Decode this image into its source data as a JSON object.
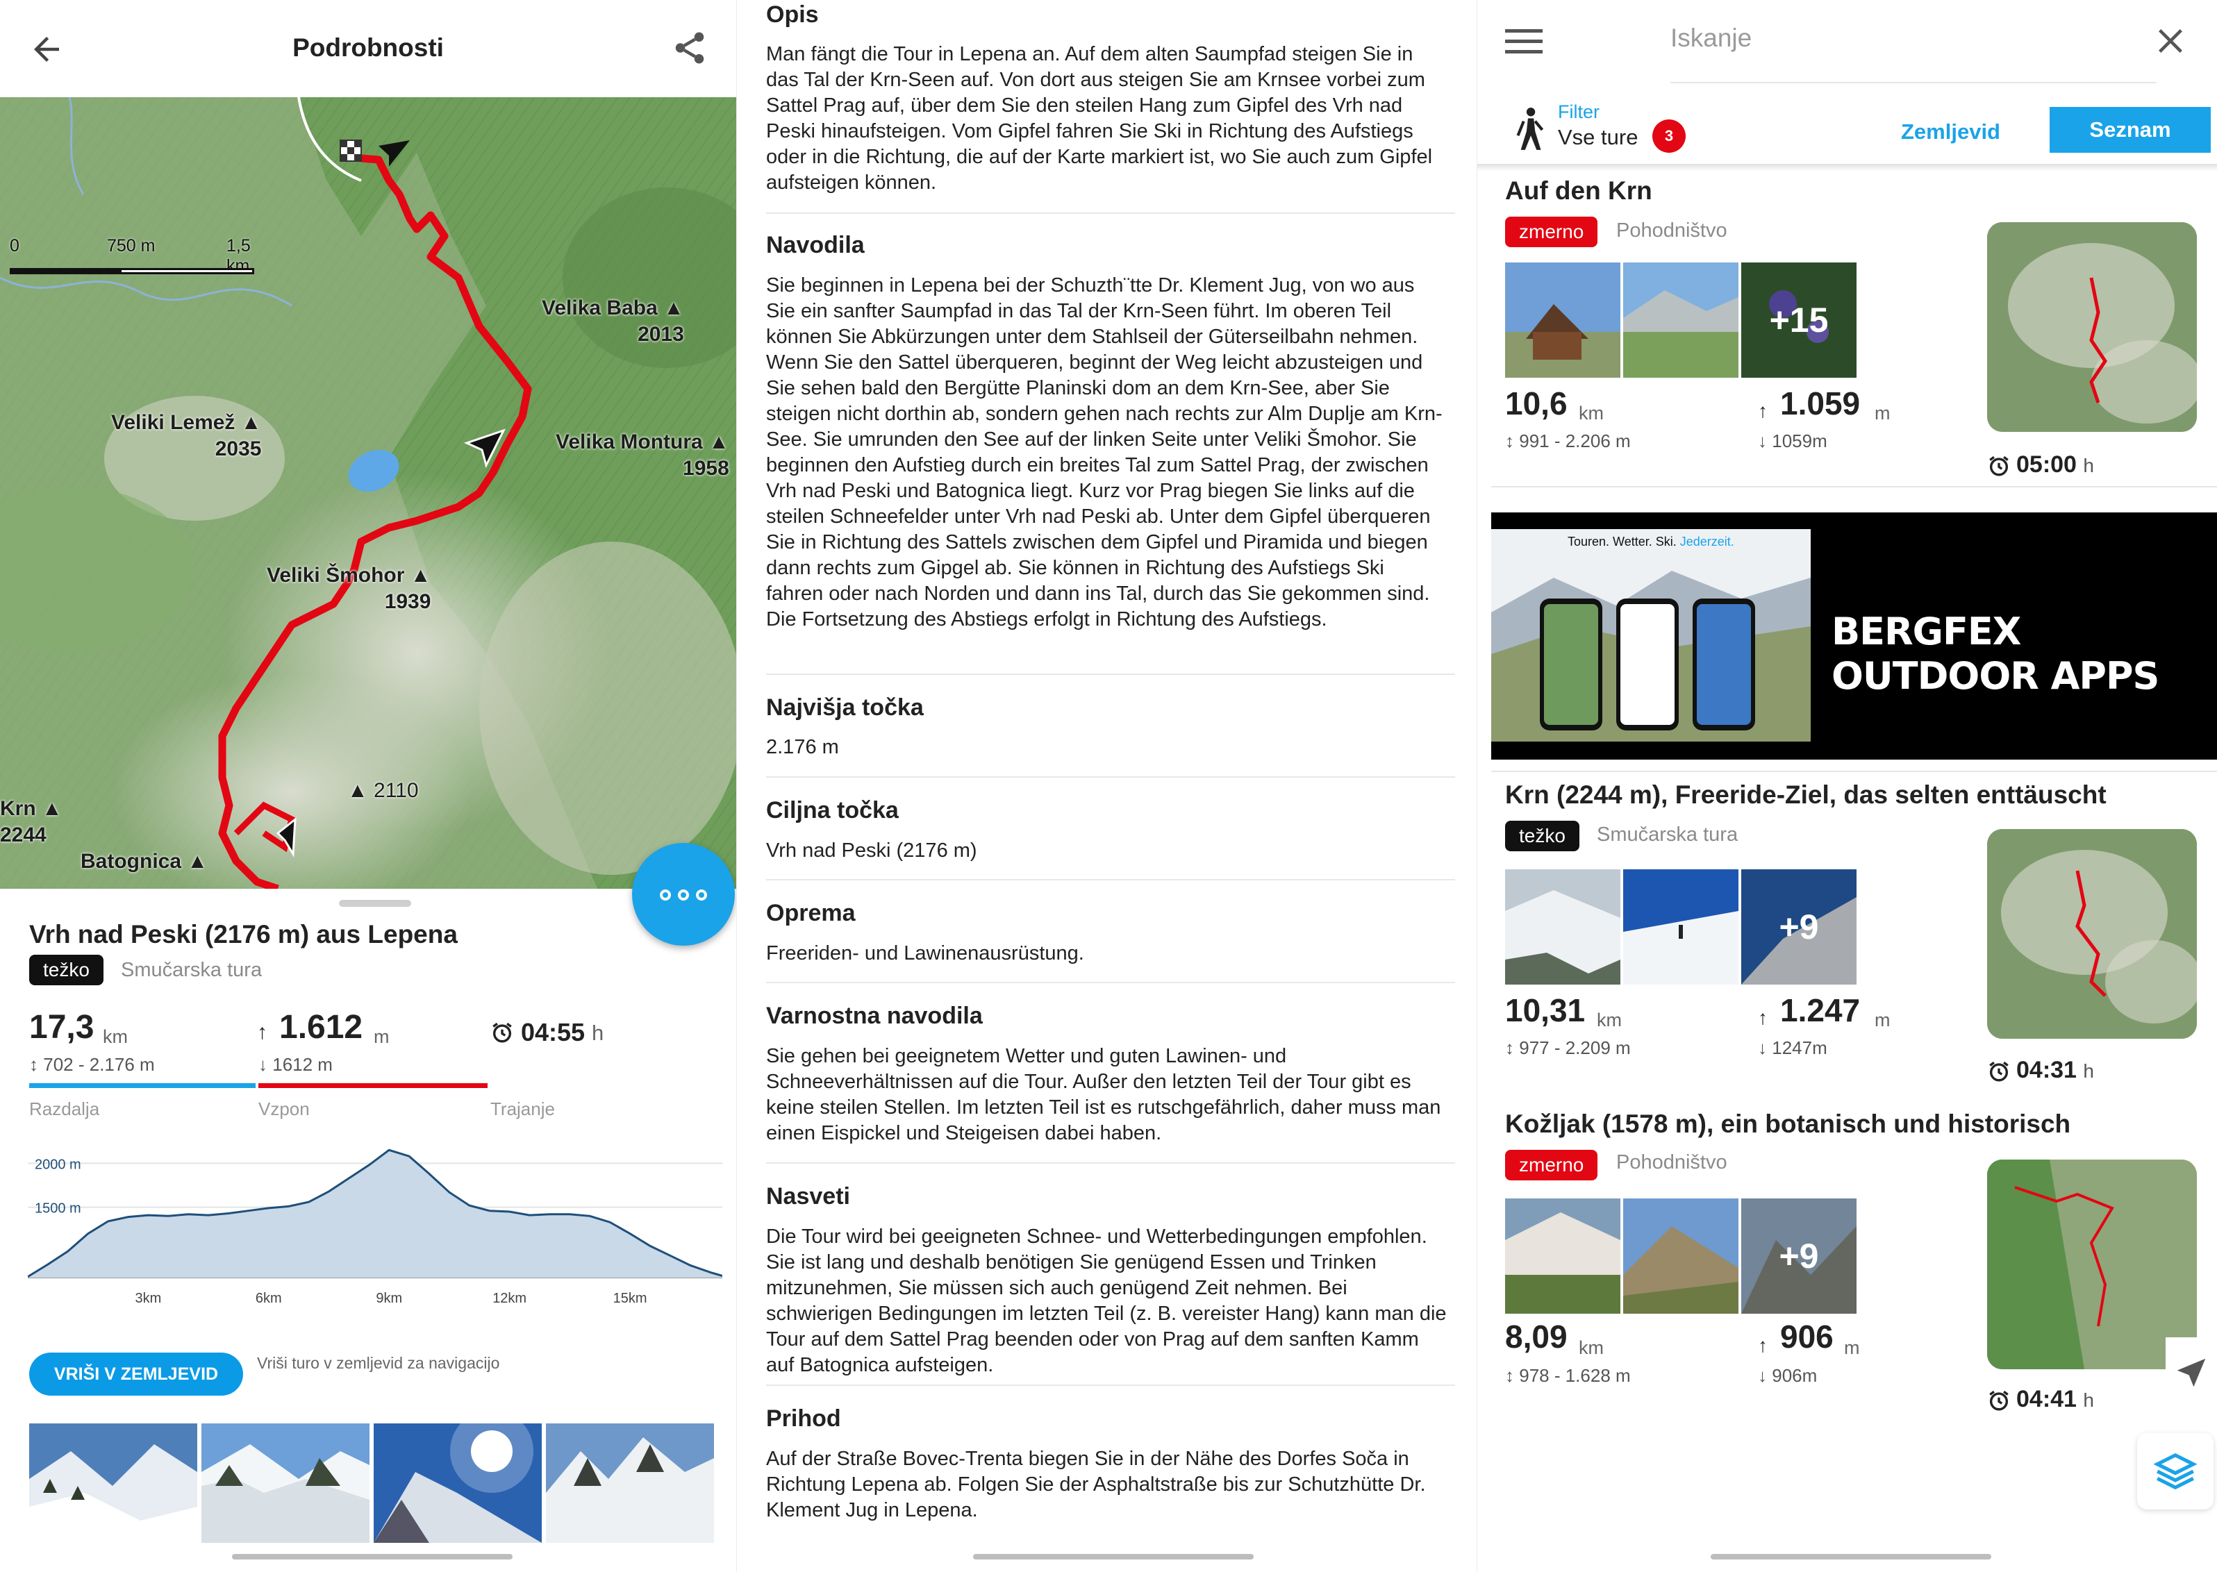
{
  "detail": {
    "title": "Podrobnosti",
    "map": {
      "scale_labels": [
        "0",
        "750 m",
        "1,5 km"
      ],
      "peaks": [
        {
          "name": "Velika Baba",
          "elev": "2013"
        },
        {
          "name": "Veliki Lemež",
          "elev": "2035"
        },
        {
          "name": "Velika Montura",
          "elev": "1958"
        },
        {
          "name": "Veliki Šmohor",
          "elev": "1939"
        },
        {
          "name": "Krn",
          "elev": "2244"
        },
        {
          "name": "Batognica",
          "elev": ""
        },
        {
          "name": "2110",
          "elev": ""
        }
      ]
    },
    "tour_title": "Vrh nad Peski (2176 m) aus Lepena",
    "difficulty": "težko",
    "category": "Smučarska tura",
    "distance": {
      "value": "17,3",
      "unit": "km",
      "range": "702 - 2.176 m",
      "label": "Razdalja"
    },
    "ascent": {
      "value": "1.612",
      "unit": "m",
      "descent": "1612 m",
      "label": "Vzpon"
    },
    "duration": {
      "value": "04:55",
      "unit": "h",
      "label": "Trajanje"
    },
    "chart_data": {
      "type": "area",
      "title": "",
      "xlabel": "",
      "ylabel": "",
      "x_ticks": [
        "3km",
        "6km",
        "9km",
        "12km",
        "15km"
      ],
      "y_ticks": [
        "2000 m",
        "1500 m"
      ],
      "xlim": [
        0,
        17.3
      ],
      "ylim": [
        700,
        2200
      ],
      "x": [
        0,
        0.5,
        1,
        1.5,
        2,
        2.5,
        3,
        3.5,
        4,
        4.5,
        5,
        5.5,
        6,
        6.5,
        7,
        7.5,
        8,
        8.5,
        9,
        9.5,
        10,
        10.5,
        11,
        11.5,
        12,
        12.5,
        13,
        13.5,
        14,
        14.5,
        15,
        15.5,
        16,
        16.5,
        17,
        17.3
      ],
      "series": [
        {
          "values": [
            710,
            850,
            1000,
            1200,
            1340,
            1390,
            1410,
            1400,
            1420,
            1410,
            1430,
            1460,
            1490,
            1510,
            1560,
            1680,
            1830,
            1980,
            2150,
            2080,
            1880,
            1670,
            1520,
            1460,
            1450,
            1410,
            1420,
            1420,
            1400,
            1330,
            1200,
            1060,
            950,
            840,
            760,
            720
          ]
        }
      ]
    },
    "map_button": "VRIŠI V ZEMLJEVID",
    "map_hint": "Vriši turo v zemljevid za navigacijo",
    "colors": {
      "accent": "#1aa3e8",
      "route": "#e30613"
    }
  },
  "info": {
    "sections": [
      {
        "heading": "Opis",
        "text": "Man fängt die Tour in Lepena an. Auf dem alten Saumpfad steigen Sie in das Tal der Krn-Seen auf. Von dort aus steigen Sie am Krnsee vorbei zum Sattel Prag auf, über dem Sie den steilen Hang zum Gipfel des Vrh nad Peski hinaufsteigen. Vom Gipfel fahren Sie Ski in Richtung des Aufstiegs oder in die Richtung, die auf der Karte markiert ist, wo Sie auch zum Gipfel aufsteigen können."
      },
      {
        "heading": "Navodila",
        "text": "Sie beginnen in Lepena bei der Schuzth¨tte Dr. Klement Jug, von wo aus Sie ein sanfter Saumpfad in das Tal der Krn-Seen führt. Im oberen Teil können Sie Abkürzungen unter dem Stahlseil der Güterseilbahn nehmen. Wenn Sie den Sattel überqueren, beginnt der Weg leicht abzusteigen und Sie sehen bald den Bergütte Planinski dom an dem Krn-See, aber Sie steigen nicht dorthin ab, sondern gehen nach rechts zur Alm Duplje am Krn-See. Sie umrunden den See auf der linken Seite unter Veliki Šmohor. Sie beginnen den Aufstieg durch ein breites Tal zum Sattel Prag, der zwischen Vrh nad Peski und Batognica liegt. Kurz vor Prag biegen Sie links auf die steilen Schneefelder unter Vrh nad Peski ab. Unter dem Gipfel überqueren Sie in Richtung des Sattels zwischen dem Gipfel und Piramida und biegen dann rechts zum Gipgel ab. Sie können in Richtung des Aufstiegs Ski fahren oder nach Norden und dann ins Tal, durch das Sie gekommen sind. Die Fortsetzung des Abstiegs erfolgt in Richtung des Aufstiegs."
      },
      {
        "heading": "Najvišja točka",
        "text": "2.176 m"
      },
      {
        "heading": "Ciljna točka",
        "text": "Vrh nad Peski (2176 m)"
      },
      {
        "heading": "Oprema",
        "text": "Freeriden- und Lawinenausrüstung."
      },
      {
        "heading": "Varnostna navodila",
        "text": "Sie gehen bei geeignetem Wetter und guten Lawinen- und Schneeverhältnissen auf die Tour. Außer den letzten Teil der Tour gibt es keine steilen Stellen. Im letzten Teil ist es rutschgefährlich, daher muss man einen Eispickel und Steigeisen dabei haben."
      },
      {
        "heading": "Nasveti",
        "text": "Die Tour wird bei geeigneten Schnee- und Wetterbedingungen empfohlen. Sie ist lang und deshalb benötigen Sie genügend Essen und Trinken mitzunehmen, Sie müssen sich auch genügend Zeit nehmen. Bei schwierigen Bedingungen im letzten Teil (z. B. vereister Hang) kann man die Tour auf dem Sattel Prag beenden oder von Prag auf dem sanften Kamm auf Batognica aufsteigen."
      },
      {
        "heading": "Prihod",
        "text": "Auf der Straße Bovec-Trenta biegen Sie in der Nähe des Dorfes Soča in Richtung Lepena ab. Folgen Sie der Asphaltstraße bis zur Schutzhütte Dr. Klement Jug in Lepena."
      }
    ]
  },
  "list": {
    "search_placeholder": "Iskanje",
    "filter_label": "Filter",
    "filter_value": "Vse ture",
    "filter_count": "3",
    "tab_map": "Zemljevid",
    "tab_list": "Seznam",
    "ad": {
      "headline": "BERGFEX OUTDOOR APPS",
      "tagline_a": "Touren. Wetter. Ski.",
      "tagline_b": "Jederzeit."
    },
    "tours": [
      {
        "title": "Auf den Krn",
        "difficulty": "zmerno",
        "category": "Pohodništvo",
        "more": "+15",
        "distance": "10,6",
        "distance_unit": "km",
        "range": "991 - 2.206 m",
        "ascent": "1.059",
        "ascent_unit": "m",
        "descent": "1059m",
        "duration": "05:00",
        "duration_unit": "h"
      },
      {
        "title": "Krn (2244 m), Freeride-Ziel, das selten enttäuscht",
        "difficulty": "težko",
        "category": "Smučarska tura",
        "more": "+9",
        "distance": "10,31",
        "distance_unit": "km",
        "range": "977 - 2.209 m",
        "ascent": "1.247",
        "ascent_unit": "m",
        "descent": "1247m",
        "duration": "04:31",
        "duration_unit": "h"
      },
      {
        "title": "Kožljak (1578 m), ein botanisch und historisch",
        "difficulty": "zmerno",
        "category": "Pohodništvo",
        "more": "+9",
        "distance": "8,09",
        "distance_unit": "km",
        "range": "978 - 1.628 m",
        "ascent": "906",
        "ascent_unit": "m",
        "descent": "906m",
        "duration": "04:41",
        "duration_unit": "h"
      }
    ]
  }
}
